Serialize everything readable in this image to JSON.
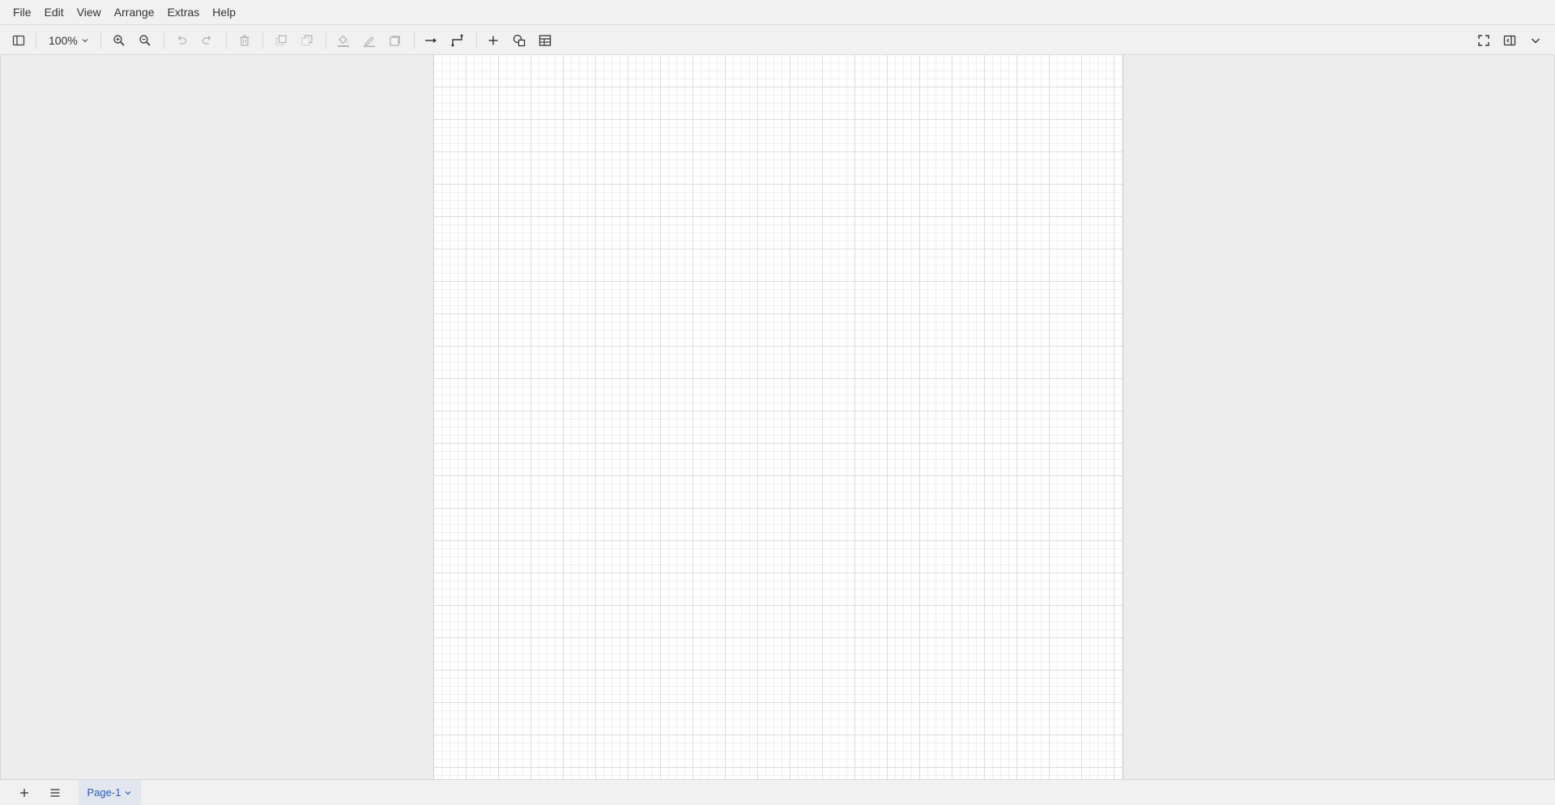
{
  "menubar": {
    "items": [
      "File",
      "Edit",
      "View",
      "Arrange",
      "Extras",
      "Help"
    ]
  },
  "toolbar": {
    "zoom_value": "100%",
    "icons": {
      "toggle_sidebar": "sidebar-toggle-icon",
      "zoom_in": "zoom-in-icon",
      "zoom_out": "zoom-out-icon",
      "undo": "undo-icon",
      "redo": "redo-icon",
      "delete": "trash-icon",
      "to_front": "to-front-icon",
      "to_back": "to-back-icon",
      "fill_color": "fill-color-icon",
      "line_color": "line-color-icon",
      "shadow": "shadow-icon",
      "connection": "connection-arrow-icon",
      "waypoints": "waypoints-icon",
      "insert": "plus-icon",
      "shapes": "shapes-icon",
      "table": "table-icon",
      "fullscreen": "fullscreen-icon",
      "format_panel": "format-panel-icon",
      "collapse": "chevron-down-icon"
    }
  },
  "footer": {
    "page_tab_label": "Page-1",
    "icons": {
      "add_page": "plus-icon",
      "pages_menu": "menu-icon"
    }
  },
  "colors": {
    "background": "#ededed",
    "bar": "#f1f1f1",
    "page": "#ffffff",
    "grid_major": "#dddddd",
    "grid_minor": "#f0f0f0",
    "active_tab_text": "#2a5db0",
    "active_tab_bg": "#e2e6ee"
  }
}
